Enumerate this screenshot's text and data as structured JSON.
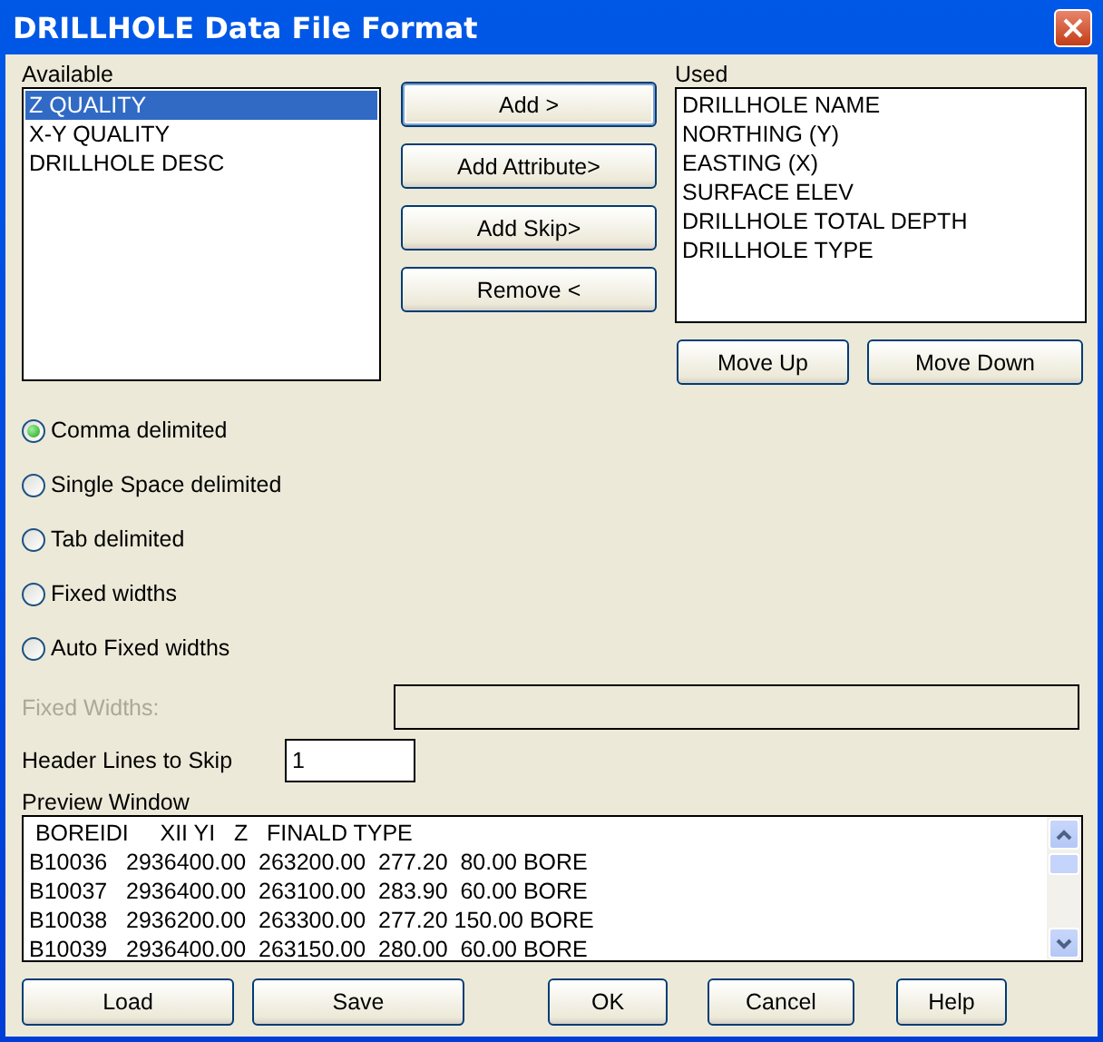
{
  "window": {
    "title": "DRILLHOLE Data File Format"
  },
  "available": {
    "label": "Available",
    "items": [
      {
        "text": "Z QUALITY",
        "selected": true
      },
      {
        "text": "X-Y QUALITY",
        "selected": false
      },
      {
        "text": "DRILLHOLE DESC",
        "selected": false
      }
    ]
  },
  "middle_buttons": [
    {
      "label": "Add >",
      "focused": true
    },
    {
      "label": "Add Attribute>",
      "focused": false
    },
    {
      "label": "Add Skip>",
      "focused": false
    },
    {
      "label": "Remove <",
      "focused": false
    }
  ],
  "used": {
    "label": "Used",
    "items": [
      {
        "text": "DRILLHOLE NAME",
        "selected": false
      },
      {
        "text": "NORTHING (Y)",
        "selected": false
      },
      {
        "text": "EASTING (X)",
        "selected": false
      },
      {
        "text": "SURFACE ELEV",
        "selected": false
      },
      {
        "text": "DRILLHOLE TOTAL DEPTH",
        "selected": false
      },
      {
        "text": "DRILLHOLE TYPE",
        "selected": false
      }
    ]
  },
  "order_buttons": [
    "Move Up",
    "Move Down"
  ],
  "delimiters": [
    {
      "label": "Comma delimited",
      "selected": true
    },
    {
      "label": "Single Space delimited",
      "selected": false
    },
    {
      "label": "Tab delimited",
      "selected": false
    },
    {
      "label": "Fixed widths",
      "selected": false
    },
    {
      "label": "Auto Fixed widths",
      "selected": false
    }
  ],
  "fixed_widths": {
    "label": "Fixed Widths:",
    "disabled": true
  },
  "header_lines": {
    "label": "Header Lines to Skip",
    "value": "1"
  },
  "preview": {
    "label": "Preview Window",
    "lines": [
      " BOREIDI     XII YI   Z   FINALD TYPE",
      "B10036   2936400.00  263200.00  277.20  80.00 BORE",
      "B10037   2936400.00  263100.00  283.90  60.00 BORE",
      "B10038   2936200.00  263300.00  277.20 150.00 BORE",
      "B10039   2936400.00  263150.00  280.00  60.00 BORE"
    ]
  },
  "bottom_buttons": [
    "Load",
    "Save",
    "OK",
    "Cancel",
    "Help"
  ]
}
